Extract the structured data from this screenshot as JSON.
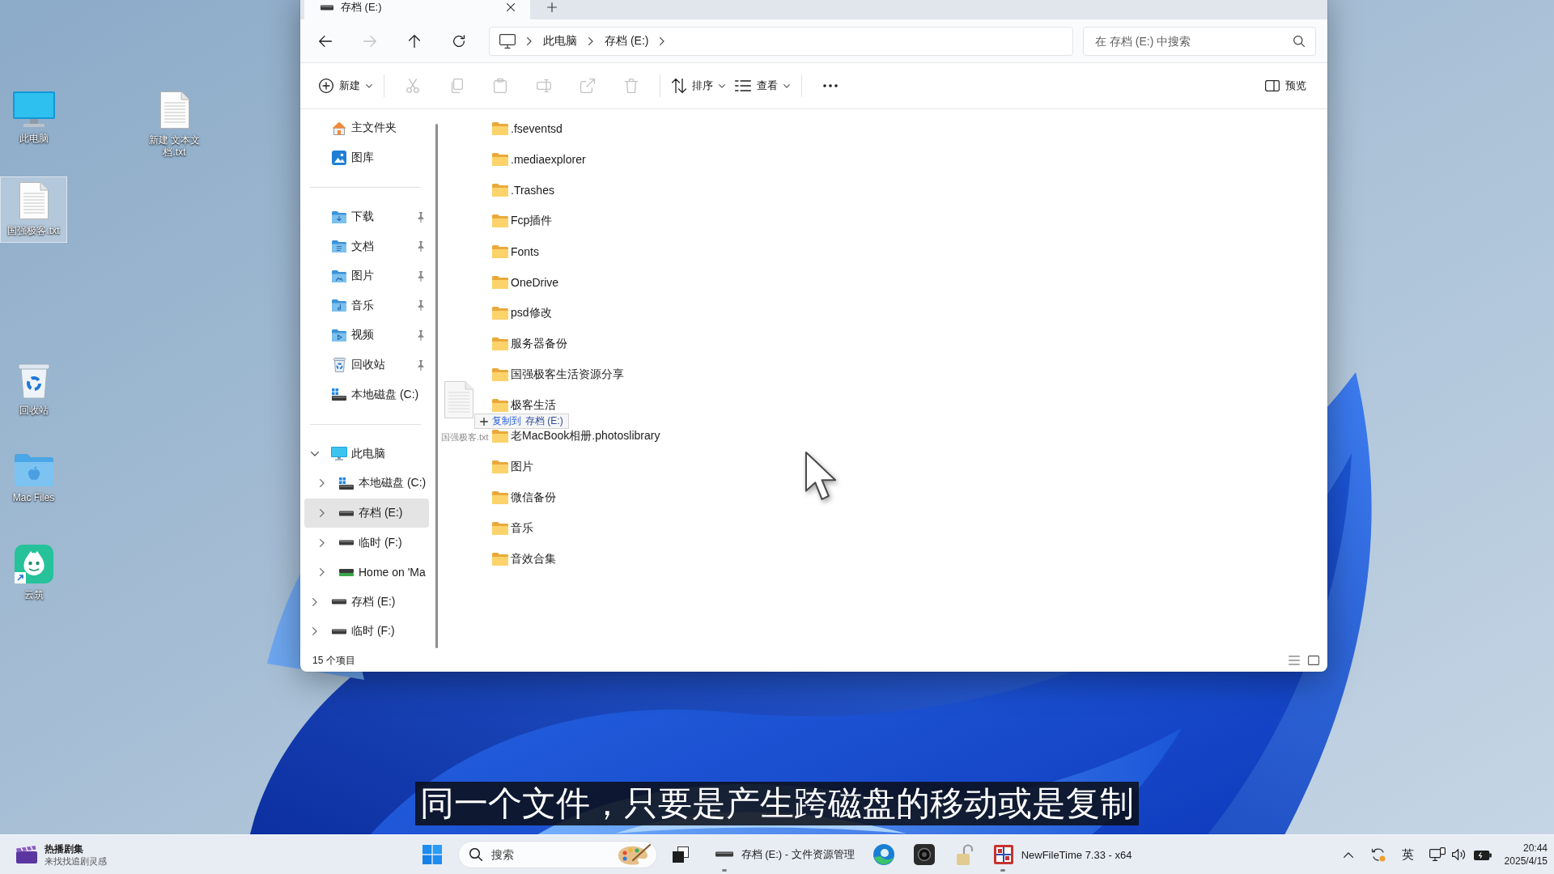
{
  "desktop_icons": [
    {
      "label": "此电脑",
      "kind": "pc",
      "selected": false
    },
    {
      "label": "新建 文本文档.txt",
      "kind": "text-file",
      "selected": false
    },
    {
      "label": "国强极客.txt",
      "kind": "text-file",
      "selected": true
    },
    {
      "label": "回收站",
      "kind": "recycle-bin",
      "selected": false
    },
    {
      "label": "Mac Files",
      "kind": "mac-folder",
      "selected": false
    },
    {
      "label": "云筑",
      "kind": "app-shortcut",
      "selected": false
    }
  ],
  "explorer": {
    "tab": {
      "title": "存档 (E:)",
      "selected": true
    },
    "nav_buttons": [
      {
        "kind": "back",
        "disabled": false
      },
      {
        "kind": "forward",
        "disabled": true
      },
      {
        "kind": "up",
        "disabled": false
      },
      {
        "kind": "refresh",
        "disabled": false
      }
    ],
    "breadcrumb": [
      "此电脑",
      "存档 (E:)"
    ],
    "search": {
      "placeholder": "在 存档 (E:) 中搜索"
    },
    "toolbar": [
      {
        "kind": "new",
        "label": "新建",
        "disabled": false,
        "dropdown": true
      },
      {
        "kind": "cut",
        "disabled": true,
        "dropdown": false
      },
      {
        "kind": "copy",
        "disabled": true,
        "dropdown": false
      },
      {
        "kind": "paste",
        "disabled": true,
        "dropdown": false
      },
      {
        "kind": "rename",
        "disabled": true,
        "dropdown": false
      },
      {
        "kind": "share",
        "disabled": true,
        "dropdown": false
      },
      {
        "kind": "delete",
        "disabled": true,
        "dropdown": false
      },
      {
        "kind": "sort",
        "label": "排序",
        "disabled": false,
        "dropdown": true
      },
      {
        "kind": "view",
        "label": "查看",
        "disabled": false,
        "dropdown": true
      },
      {
        "kind": "more",
        "disabled": false,
        "dropdown": false
      }
    ],
    "preview_button": {
      "label": "预览"
    },
    "sidebar": {
      "groups": [
        {
          "items": [
            {
              "label": "主文件夹",
              "kind": "home",
              "pinned": false,
              "selected": false
            },
            {
              "label": "图库",
              "kind": "gallery",
              "pinned": false,
              "selected": false
            }
          ]
        },
        {
          "items": [
            {
              "label": "下载",
              "kind": "downloads",
              "pinned": true,
              "selected": false
            },
            {
              "label": "文档",
              "kind": "documents",
              "pinned": true,
              "selected": false
            },
            {
              "label": "图片",
              "kind": "pictures",
              "pinned": true,
              "selected": false
            },
            {
              "label": "音乐",
              "kind": "music",
              "pinned": true,
              "selected": false
            },
            {
              "label": "视频",
              "kind": "videos",
              "pinned": true,
              "selected": false
            },
            {
              "label": "回收站",
              "kind": "recycle-bin",
              "pinned": true,
              "selected": false
            },
            {
              "label": "本地磁盘 (C:)",
              "kind": "local-disk",
              "pinned": false,
              "selected": false
            }
          ]
        }
      ],
      "tree": [
        {
          "label": "此电脑",
          "kind": "pc",
          "expanded": true,
          "selected": false,
          "children": [
            {
              "label": "本地磁盘 (C:)",
              "kind": "local-disk",
              "expanded": false,
              "selected": false
            },
            {
              "label": "存档 (E:)",
              "kind": "drive",
              "expanded": false,
              "selected": true
            },
            {
              "label": "临时 (F:)",
              "kind": "drive",
              "expanded": false,
              "selected": false
            },
            {
              "label": "Home on 'Ma",
              "kind": "network-drive",
              "expanded": false,
              "selected": false
            }
          ]
        },
        {
          "label": "存档 (E:)",
          "kind": "drive",
          "expanded": false,
          "selected": false
        },
        {
          "label": "临时 (F:)",
          "kind": "drive",
          "expanded": false,
          "selected": false
        }
      ]
    },
    "files": [
      ".fseventsd",
      ".mediaexplorer",
      ".Trashes",
      "Fcp插件",
      "Fonts",
      "OneDrive",
      "psd修改",
      "服务器备份",
      "国强极客生活资源分享",
      "极客生活",
      "老MacBook相册.photoslibrary",
      "图片",
      "微信备份",
      "音乐",
      "音效合集"
    ],
    "status_bar": {
      "item_count": "15 个项目"
    },
    "drag": {
      "file_label": "国强极客.txt",
      "action": "复制到",
      "target": "存档 (E:)"
    }
  },
  "subtitle": "同一个文件，只要是产生跨磁盘的移动或是复制",
  "taskbar": {
    "widget": {
      "title": "热播剧集",
      "subtitle": "来找找追剧灵感"
    },
    "search": {
      "placeholder": "搜索"
    },
    "apps": [
      {
        "kind": "task-view",
        "running": false
      },
      {
        "kind": "explorer",
        "label": "存档 (E:) - 文件资源管理",
        "running": true
      },
      {
        "kind": "browser",
        "running": false
      },
      {
        "kind": "camera",
        "running": false
      },
      {
        "kind": "lock",
        "running": false
      },
      {
        "kind": "newfiletime",
        "label": "NewFileTime 7.33 - x64",
        "running": true
      }
    ],
    "tray": {
      "input_method": "英",
      "time": "20:44",
      "date": "2025/4/15"
    }
  }
}
